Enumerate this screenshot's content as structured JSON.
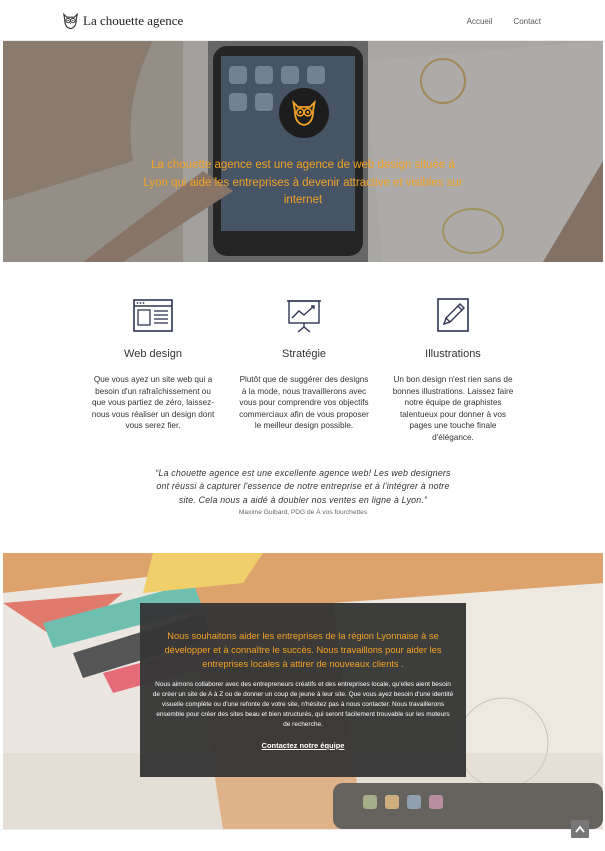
{
  "header": {
    "site_title": "La chouette agence",
    "nav": [
      {
        "label": "Accueil"
      },
      {
        "label": "Contact"
      }
    ]
  },
  "hero": {
    "tagline": "La chouette agence est une agence de web design située à Lyon qui aide les entreprises à devenir attractive et visibles sur internet"
  },
  "services": [
    {
      "icon": "web-design-icon",
      "title": "Web design",
      "text": "Que vous ayez un site web qui a besoin d'un rafraîchissement ou que vous partiez de zéro, laissez-nous vous réaliser un design dont vous serez fier."
    },
    {
      "icon": "strategy-chart-icon",
      "title": "Stratégie",
      "text": "Plutôt que de suggérer des designs à la mode, nous travaillerons avec vous pour comprendre vos objectifs commerciaux afin de vous proposer le meilleur design possible."
    },
    {
      "icon": "pencil-icon",
      "title": "Illustrations",
      "text": "Un bon design n'est rien sans de bonnes illustrations. Laissez faire notre équipe de graphistes talentueux pour donner à vos pages une touche finale d'élégance."
    }
  ],
  "testimonial": {
    "quote": "“La chouette agence est une excellente agence web! Les web designers ont réussi à capturer l'essence de notre entreprise et à l'intégrer à notre site. Cela nous a aidé à doubler nos ventes en ligne à Lyon.”",
    "author": "Maxime Guibard, PDG de À vos fourchettes"
  },
  "cta": {
    "heading": "Nous souhaitons aider les entreprises de la région Lyonnaise à se développer et à connaître le succès. Nous travaillons pour aider les entreprises locales à attirer de nouveaux clients .",
    "body": "Nous aimons collaborer avec des entrepreneurs créatifs et des entreprises locale, qu'elles aient besoin de créer un site de A à Z ou de donner un coup de jeune à leur site. Que vous ayez besoin d'une identité visuelle complète ou d'une refonte de votre site, n'hésitez pas à nous contacter. Nous travaillerons ensemble pour créer des sites beau et bien structurés, qui seront facilement trouvable sur les moteurs de recherche.",
    "link": "Contactez notre équipe"
  },
  "colors": {
    "accent": "#f2a326",
    "icon_navy": "#2f3552",
    "box_bg": "#373737"
  },
  "scroll_top": {
    "icon": "arrow-up-icon"
  }
}
